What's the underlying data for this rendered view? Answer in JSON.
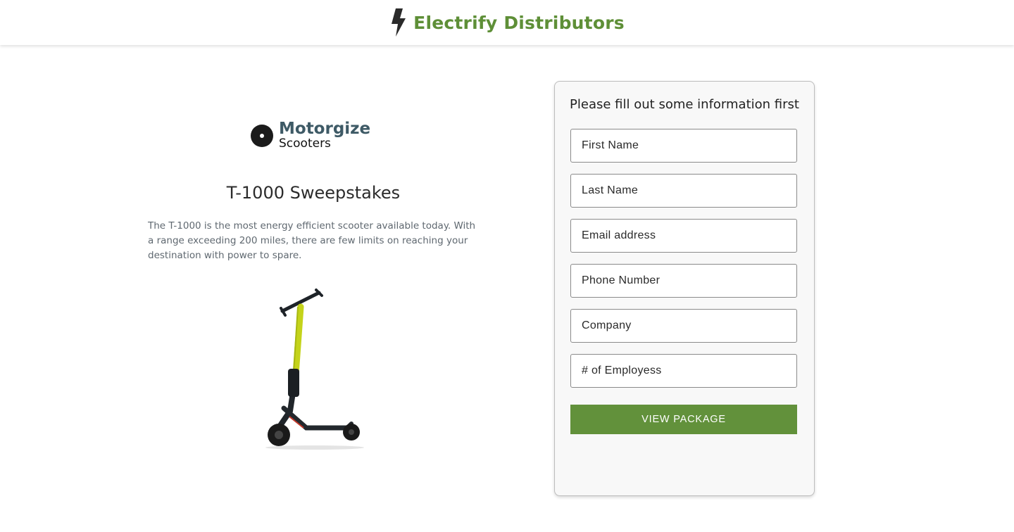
{
  "header": {
    "brand_name": "Electrify Distributors",
    "icon": "lightning-bolt-icon",
    "brand_color": "#5e8f37"
  },
  "promo": {
    "logo": {
      "main": "Motorgize",
      "sub": "Scooters",
      "icon": "circle-dot-icon"
    },
    "title": "T-1000 Sweepstakes",
    "description": "The T-1000 is the most energy efficient scooter available today. With a range exceeding 200 miles, there are few limits on reaching your destination with power to spare.",
    "image": "electric-scooter-image",
    "accent_color": "#c4d31a"
  },
  "form": {
    "title": "Please fill out some information first",
    "fields": [
      {
        "placeholder": "First Name",
        "value": ""
      },
      {
        "placeholder": "Last Name",
        "value": ""
      },
      {
        "placeholder": "Email address",
        "value": ""
      },
      {
        "placeholder": "Phone Number",
        "value": ""
      },
      {
        "placeholder": "Company",
        "value": ""
      },
      {
        "placeholder": "# of Employess",
        "value": ""
      }
    ],
    "submit_label": "VIEW PACKAGE",
    "button_color": "#62913b"
  }
}
